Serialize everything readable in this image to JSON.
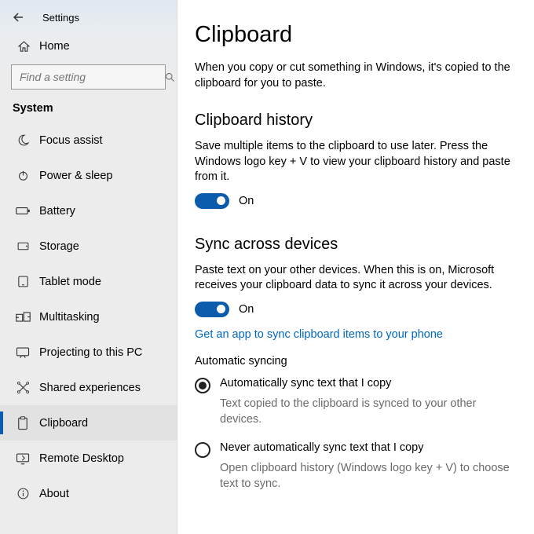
{
  "header": {
    "title": "Settings"
  },
  "sidebar": {
    "home_label": "Home",
    "search_placeholder": "Find a setting",
    "category": "System",
    "items": [
      {
        "label": "Focus assist"
      },
      {
        "label": "Power & sleep"
      },
      {
        "label": "Battery"
      },
      {
        "label": "Storage"
      },
      {
        "label": "Tablet mode"
      },
      {
        "label": "Multitasking"
      },
      {
        "label": "Projecting to this PC"
      },
      {
        "label": "Shared experiences"
      },
      {
        "label": "Clipboard"
      },
      {
        "label": "Remote Desktop"
      },
      {
        "label": "About"
      }
    ]
  },
  "main": {
    "title": "Clipboard",
    "intro": "When you copy or cut something in Windows, it's copied to the clipboard for you to paste.",
    "history": {
      "heading": "Clipboard history",
      "desc": "Save multiple items to the clipboard to use later. Press the Windows logo key + V to view your clipboard history and paste from it.",
      "toggle_label": "On"
    },
    "sync": {
      "heading": "Sync across devices",
      "desc": "Paste text on your other devices. When this is on, Microsoft receives your clipboard data to sync it across your devices.",
      "toggle_label": "On",
      "link": "Get an app to sync clipboard items to your phone",
      "auto_heading": "Automatic syncing",
      "radio1_label": "Automatically sync text that I copy",
      "radio1_sub": "Text copied to the clipboard is synced to your other devices.",
      "radio2_label": "Never automatically sync text that I copy",
      "radio2_sub": "Open clipboard history (Windows logo key + V) to choose text to sync."
    }
  }
}
